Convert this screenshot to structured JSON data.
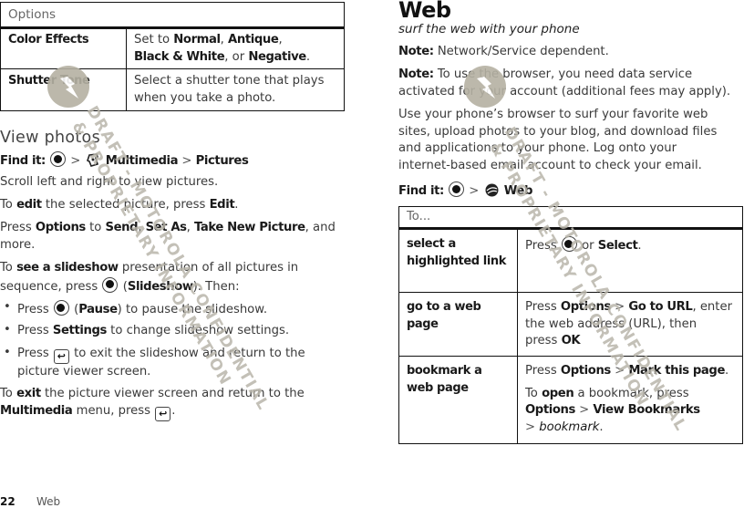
{
  "left": {
    "options_table": {
      "header": "Options",
      "rows": [
        {
          "label": "Color Effects",
          "desc_prefix": "Set to ",
          "opt1": "Normal",
          "sep1": ", ",
          "opt2": "Antique",
          "sep2": ",",
          "opt3": "Black & White",
          "sep3": ", or ",
          "opt4": "Negative",
          "end": "."
        },
        {
          "label": "Shutter Tone",
          "desc_line1": "Select a shutter tone that plays",
          "desc_line2": "when you take a photo."
        }
      ]
    },
    "section_title": "View photos",
    "find_it": {
      "label": "Find it:",
      "sep": ">",
      "app": "Multimedia",
      "sep2": ">",
      "item": "Pictures"
    },
    "scroll_text": "Scroll left and right to view pictures.",
    "edit": {
      "pre": "To ",
      "action": "edit",
      "mid": " the selected picture, press ",
      "key": "Edit",
      "end": "."
    },
    "options": {
      "pre": "Press ",
      "key": "Options",
      "mid": " to ",
      "a": "Send",
      "c1": ", ",
      "b": "Set As",
      "c2": ", ",
      "c": "Take New Picture",
      "end": ", and",
      "line2": "more."
    },
    "slideshow": {
      "pre": "To ",
      "action": "see a slideshow",
      "mid": " presentation of all pictures in",
      "line2_pre": "sequence, press ",
      "paren_open": "(",
      "key": "Slideshow",
      "line2_end": "). Then:"
    },
    "bullets": [
      {
        "pre": "Press ",
        "paren_open": "(",
        "key": "Pause",
        "end": ") to pause the slideshow."
      },
      {
        "pre": "Press ",
        "key": "Settings",
        "end": " to change slideshow settings."
      },
      {
        "pre": "Press ",
        "end": " to exit the slideshow and return to the",
        "line2": "picture viewer screen."
      }
    ],
    "exit": {
      "pre": "To ",
      "action": "exit",
      "mid": " the picture viewer screen and return to the",
      "menu": "Multimedia",
      "line2": " menu, press ",
      "end": "."
    }
  },
  "right": {
    "title": "Web",
    "subtitle": "surf the web with your phone",
    "note1": {
      "label": "Note:",
      "text": " Network/Service dependent."
    },
    "note2": {
      "label": "Note:",
      "text": " To use the browser, you need data service",
      "line2": "activated for your account (additional fees may apply)."
    },
    "body": [
      "Use your phone’s browser to surf your favorite web",
      "sites, upload photos to your blog, and download files",
      "and applications to your phone. Log onto your",
      "internet-based email account to check your email."
    ],
    "find_it": {
      "label": "Find it:",
      "sep": ">",
      "app": "Web"
    },
    "table": {
      "header": "To...",
      "rows": [
        {
          "label": "select a highlighted link",
          "pre": "Press ",
          "mid": " or ",
          "key": "Select",
          "end": "."
        },
        {
          "label": "go to a web page",
          "pre": "Press ",
          "key1": "Options",
          "sep": " > ",
          "key2": "Go to URL",
          "end": ", enter",
          "line2": "the web address (URL), then",
          "line3_pre": "press ",
          "line3_key": "OK"
        },
        {
          "label": "bookmark a web page",
          "pre": "Press ",
          "key1": "Options",
          "sep": " > ",
          "key2": "Mark this page",
          "end": ".",
          "p2_pre": "To ",
          "p2_action": "open",
          "p2_mid": " a bookmark, press",
          "p2_key1": "Options",
          "p2_sep": " > ",
          "p2_key2": "View Bookmarks",
          "p2_sep2": "> ",
          "p2_item": "bookmark",
          "p2_end": "."
        }
      ]
    }
  },
  "footer": {
    "page_number": "22",
    "section": "Web"
  },
  "watermark": {
    "line1": "DRAFT - MOTOROLA CONFIDENTIAL",
    "line2": "& PROPRIETARY INFORMATION"
  },
  "colors": {
    "text": "#3a3a3a",
    "bold": "#1a1a1a",
    "watermark": "#b9b6ab",
    "logo": "#b5b1a3",
    "rule": "#111111"
  }
}
